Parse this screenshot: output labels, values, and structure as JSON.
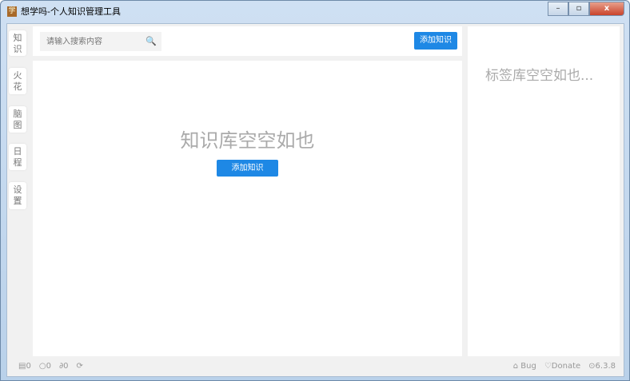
{
  "window": {
    "title": "想学吗-个人知识管理工具",
    "app_icon": "学",
    "min": "–",
    "max": "▫",
    "close": "x"
  },
  "sidebar": [
    {
      "label": "知\n识"
    },
    {
      "label": "火\n花"
    },
    {
      "label": "脑\n图"
    },
    {
      "label": "日\n程"
    },
    {
      "label": "设\n置"
    }
  ],
  "search": {
    "placeholder": "请输入搜索内容"
  },
  "toolbar": {
    "add_label": "添加知识"
  },
  "main": {
    "empty_text": "知识库空空如也",
    "add_label": "添加知识"
  },
  "tags": {
    "empty_text": "标签库空空如也..."
  },
  "status": {
    "left": [
      "0",
      "0",
      "0"
    ],
    "bug": "Bug",
    "donate": "Donate",
    "version": "6.3.8"
  }
}
